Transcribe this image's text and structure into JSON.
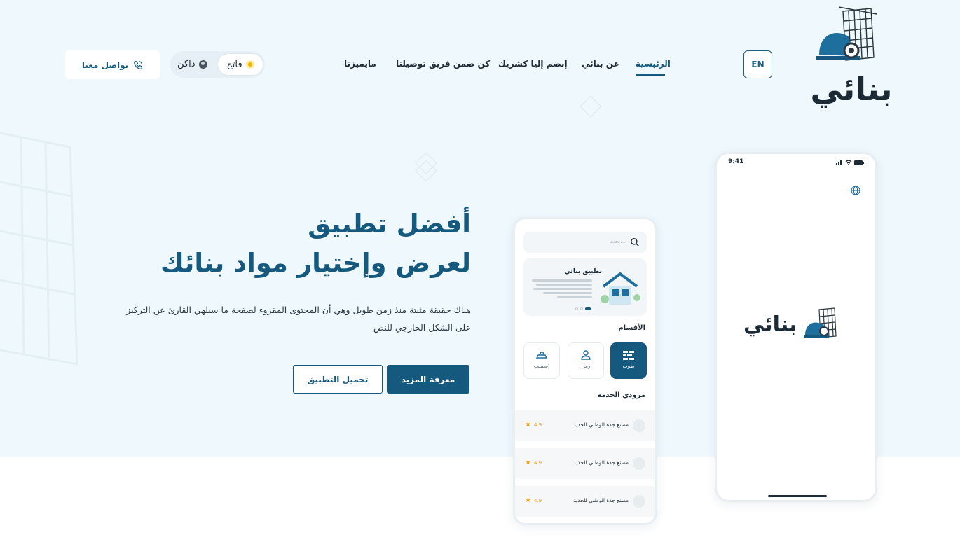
{
  "brand": {
    "name": "بنائي"
  },
  "header": {
    "lang_button": "EN",
    "nav": [
      "الرئيسية",
      "عن بنائي",
      "إنضم إليا كشريك",
      "كن ضمن فريق توصيلنا",
      "مايميزنا"
    ],
    "active_nav": "الرئيسية",
    "theme": {
      "light_label": "فاتح",
      "dark_label": "داكن",
      "selected": "light"
    },
    "contact_button": "تواصل معنا"
  },
  "hero": {
    "title_line1": "أفضل تطبيق",
    "title_line2": "لعرض وإختيار مواد بنائك",
    "description": "هناك حقيقة مثبتة منذ زمن طويل وهي أن المحتوى المقروء لصفحة ما سيلهي القارئ عن التركيز على الشكل الخارجي للنص",
    "primary_button": "معرفة المزيد",
    "secondary_button": "تحميل التطبيق"
  },
  "app_mockup": {
    "search_placeholder": "بحث...",
    "banner_title": "تطبيق بنائي",
    "categories_title": "الأقسام",
    "categories": [
      {
        "label": "طوب",
        "icon": "bricks-icon",
        "selected": true
      },
      {
        "label": "رمل",
        "icon": "sand-icon",
        "selected": false
      },
      {
        "label": "إسمنت",
        "icon": "cement-icon",
        "selected": false
      }
    ],
    "providers_title": "مزودي الخدمة",
    "providers": [
      {
        "name": "مصنع جدة الوطني للحديد",
        "rating": "4.9"
      },
      {
        "name": "مصنع جدة الوطني للحديد",
        "rating": "4.9"
      },
      {
        "name": "مصنع جدة الوطني للحديد",
        "rating": "4.9"
      }
    ]
  },
  "splash_mockup": {
    "time": "9:41",
    "logo_text": "بنائي"
  },
  "colors": {
    "primary": "#15597f",
    "hero_bg": "#eef8fd",
    "rating": "#f5a21d"
  }
}
